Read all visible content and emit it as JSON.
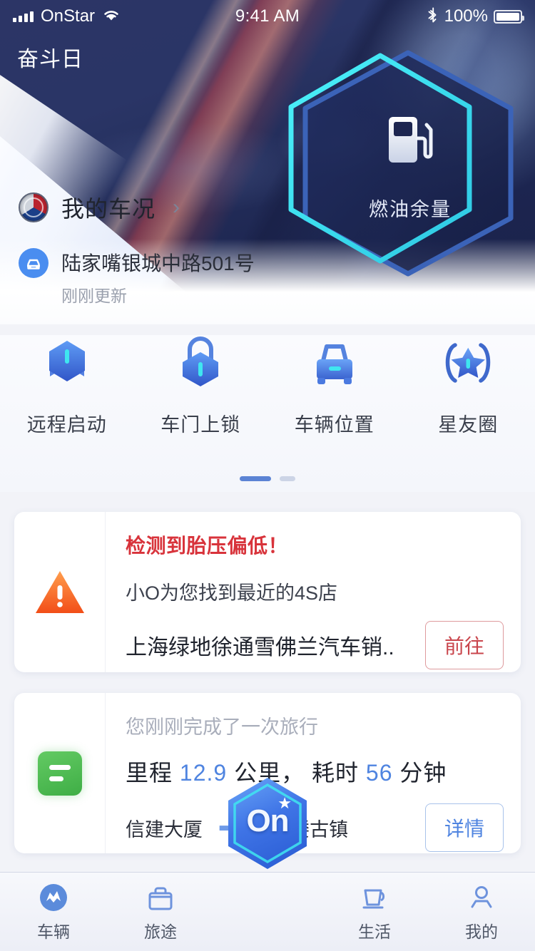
{
  "status_bar": {
    "carrier": "OnStar",
    "time": "9:41 AM",
    "battery_percent": "100%",
    "signal_icon": "signal-bars-icon",
    "wifi_icon": "wifi-icon",
    "bluetooth_icon": "bluetooth-icon",
    "battery_icon": "battery-full-icon"
  },
  "header": {
    "app_title": "奋斗日"
  },
  "fuel_hex": {
    "label": "燃油余量",
    "icon": "fuel-pump-icon",
    "accent_color": "#3fe6f0",
    "ring_color": "#3b63b8"
  },
  "vehicle": {
    "brand_icon": "buick-logo-icon",
    "title": "我的车况",
    "chevron": "›",
    "location_icon": "car-icon",
    "address": "陆家嘴银城中路501号",
    "updated": "刚刚更新"
  },
  "quick_actions": [
    {
      "label": "远程启动",
      "icon": "remote-start-icon"
    },
    {
      "label": "车门上锁",
      "icon": "door-lock-icon"
    },
    {
      "label": "车辆位置",
      "icon": "vehicle-location-icon"
    },
    {
      "label": "星友圈",
      "icon": "star-circle-icon"
    }
  ],
  "pager": {
    "active_index": 0,
    "count": 2,
    "active_color": "#5b83d4",
    "inactive_color": "#ccd4e6"
  },
  "alert_card": {
    "icon": "warning-triangle-icon",
    "title": "检测到胎压偏低！",
    "subtitle": "小O为您找到最近的4S店",
    "dealer": "上海绿地徐通雪佛兰汽车销..",
    "button": "前往",
    "title_color": "#d8333b",
    "button_color": "#c9454c"
  },
  "trip_card": {
    "icon": "trip-list-icon",
    "headline": "您刚刚完成了一次旅行",
    "distance_prefix": "里程",
    "distance_value": "12.9",
    "distance_unit": "公里，",
    "duration_prefix": "耗时",
    "duration_value": "56",
    "duration_unit": "分钟",
    "origin": "信建大厦",
    "arrow": "➡",
    "destination": "召稼楼古镇",
    "button": "详情",
    "accent_color": "#4f84e0"
  },
  "tab_bar": {
    "items": [
      {
        "label": "车辆",
        "icon": "vehicle-tab-icon",
        "active": true
      },
      {
        "label": "旅途",
        "icon": "suitcase-tab-icon",
        "active": false
      },
      {
        "label": "生活",
        "icon": "cup-tab-icon",
        "active": false
      },
      {
        "label": "我的",
        "icon": "person-tab-icon",
        "active": false
      }
    ],
    "center": {
      "label": "On",
      "icon": "onstar-hex-icon"
    }
  }
}
